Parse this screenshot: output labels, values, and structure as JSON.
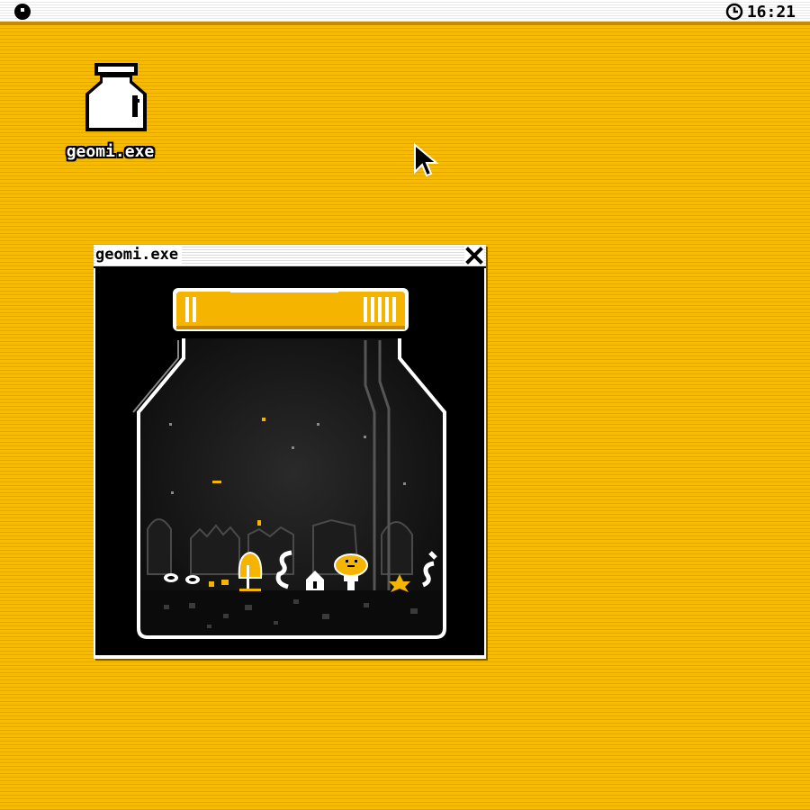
{
  "menubar": {
    "clock": "16:21"
  },
  "desktop": {
    "icon_label": "geomi.exe"
  },
  "window": {
    "title": "geomi.exe"
  },
  "colors": {
    "desktop": "#f7bb06",
    "accent": "#f5b400",
    "jar_bg": "#000000"
  }
}
